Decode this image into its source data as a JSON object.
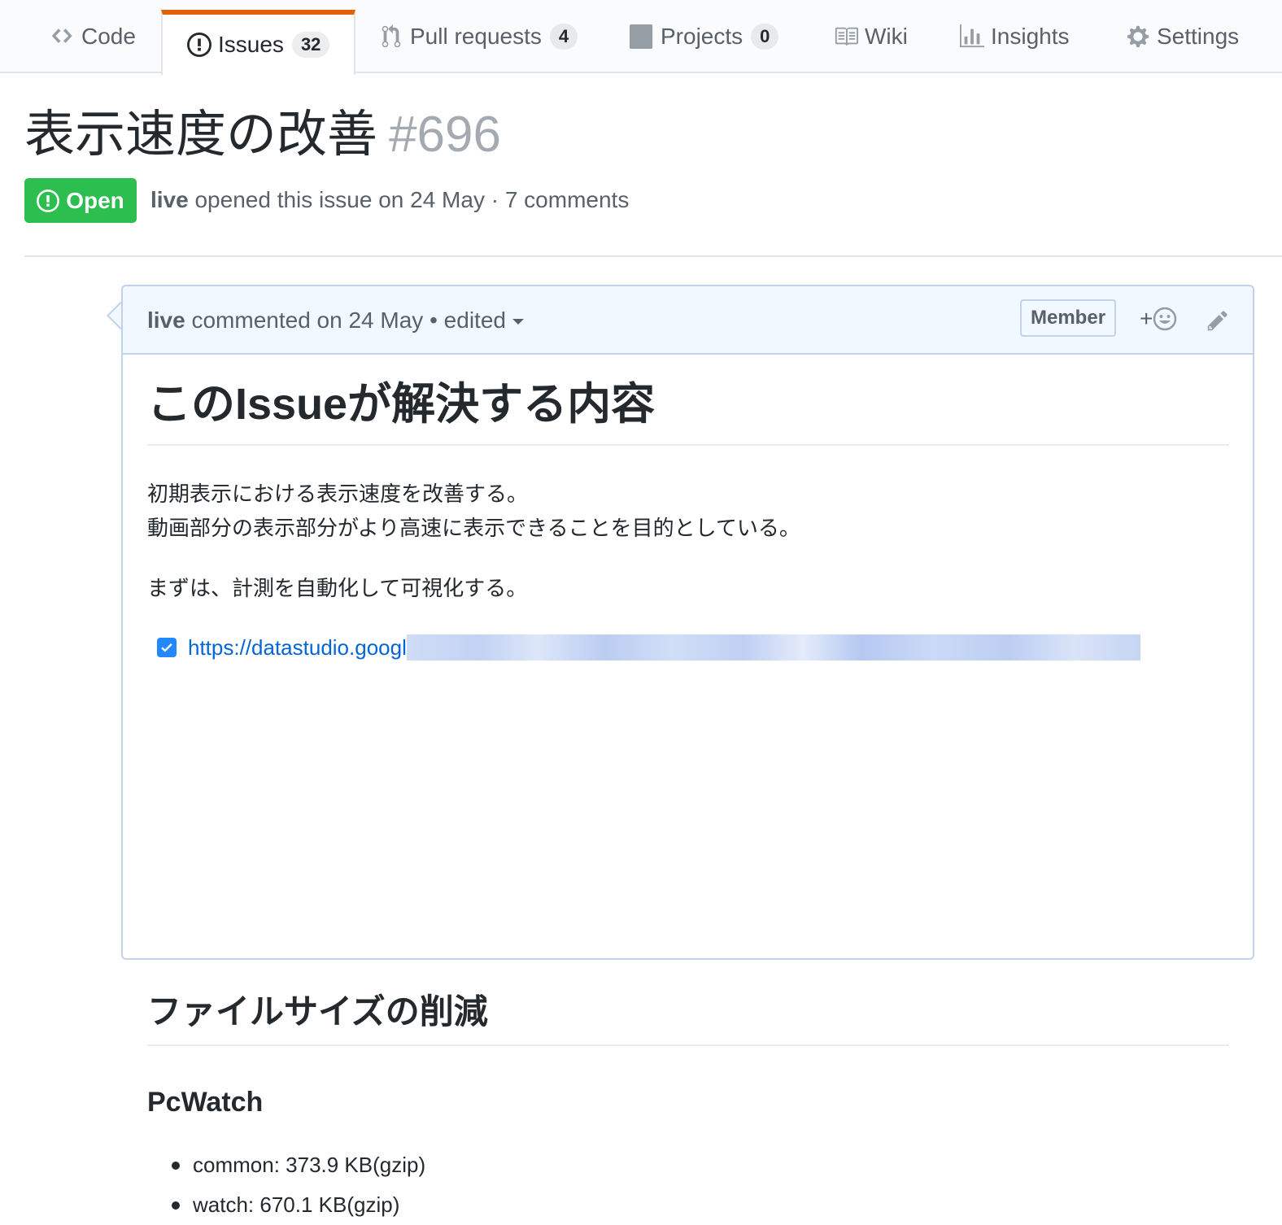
{
  "tabs": [
    {
      "label": "Code",
      "icon": "code-icon"
    },
    {
      "label": "Issues",
      "icon": "issue-opened-icon",
      "count": "32",
      "selected": true
    },
    {
      "label": "Pull requests",
      "icon": "git-pull-request-icon",
      "count": "4"
    },
    {
      "label": "Projects",
      "icon": "project-icon",
      "count": "0"
    },
    {
      "label": "Wiki",
      "icon": "book-icon"
    },
    {
      "label": "Insights",
      "icon": "graph-icon"
    },
    {
      "label": "Settings",
      "icon": "gear-icon"
    }
  ],
  "issue": {
    "title": "表示速度の改善",
    "number": "#696",
    "state": "Open",
    "author": "live",
    "meta_text": "opened this issue on 24 May · 7 comments"
  },
  "comment": {
    "author": "live",
    "meta_text": "commented on 24 May",
    "separator": "•",
    "edited_label": "edited",
    "role_label": "Member",
    "reaction_label": "+",
    "body": {
      "heading1": "このIssueが解決する内容",
      "paragraph1_line1": "初期表示における表示速度を改善する。",
      "paragraph1_line2": "動画部分の表示部分がより高速に表示できることを目的としている。",
      "paragraph2": "まずは、計測を自動化して可視化する。",
      "task_link": "https://datastudio.googl",
      "task_checked": true,
      "heading2": "ファイルサイズの削減",
      "heading3": "PcWatch",
      "list_items": [
        "common: 373.9 KB(gzip)",
        "watch: 670.1 KB(gzip)"
      ]
    }
  },
  "colors": {
    "open_green": "#2cbe4e",
    "selected_tab_accent": "#e36209",
    "link_blue": "#0366d6",
    "comment_header_bg": "#f1f8ff"
  }
}
